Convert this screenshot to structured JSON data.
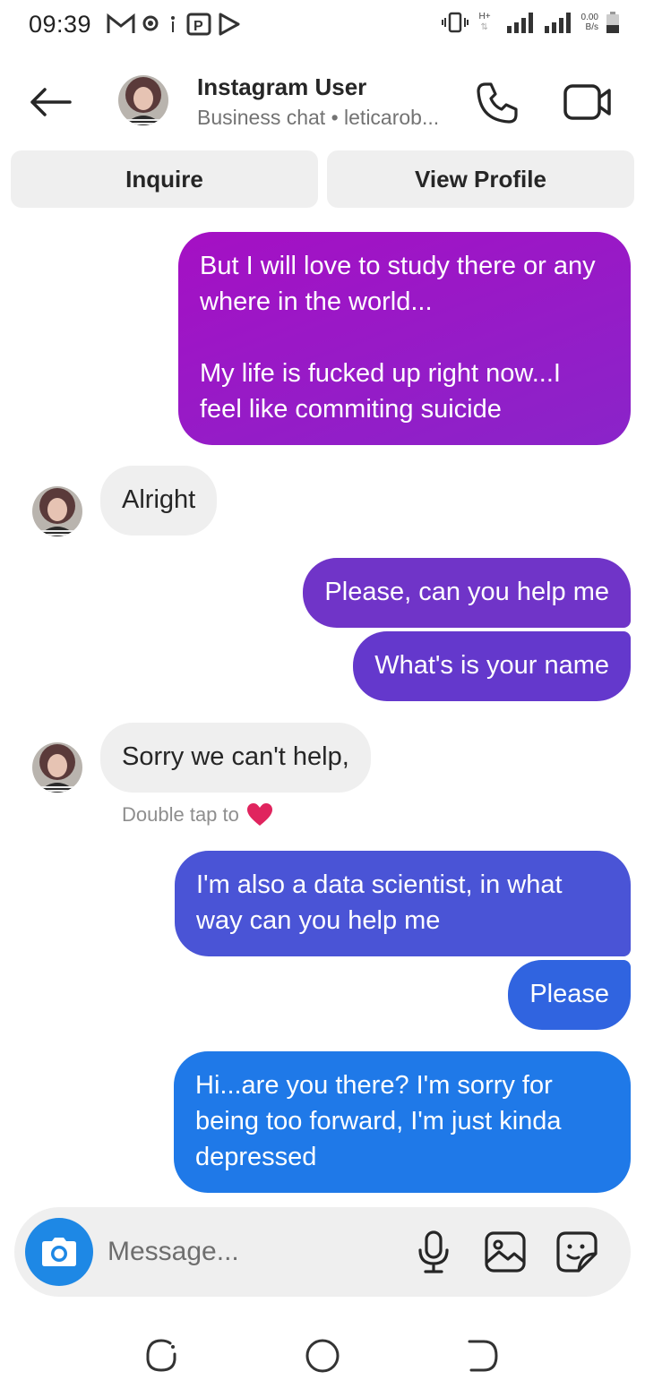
{
  "status_bar": {
    "time": "09:39",
    "net_speed_value": "0.00",
    "net_speed_unit": "B/s",
    "network_type": "H+"
  },
  "header": {
    "name": "Instagram User",
    "subtitle": "Business chat • leticarob...",
    "icons": [
      "back-arrow-icon",
      "phone-icon",
      "video-camera-icon"
    ]
  },
  "actions": {
    "inquire": "Inquire",
    "view_profile": "View Profile"
  },
  "messages": [
    {
      "direction": "out",
      "text_line1": "But I will love to study there or any where in the world...",
      "text_line2": "My life is fucked up right now...I feel like commiting suicide"
    },
    {
      "direction": "in",
      "text": "Alright"
    },
    {
      "direction": "out",
      "text": "Please, can you help me"
    },
    {
      "direction": "out",
      "text": "What's is your name"
    },
    {
      "direction": "in",
      "text": "Sorry we can't help,"
    },
    {
      "direction": "out",
      "text": "I'm also a data scientist, in what way can you help me"
    },
    {
      "direction": "out",
      "text": "Please"
    },
    {
      "direction": "out",
      "text": "Hi...are you there? I'm sorry for being too forward, I'm just kinda depressed"
    }
  ],
  "hint": {
    "text": "Double tap to",
    "icon": "heart-icon",
    "color": "#e0245e"
  },
  "composer": {
    "placeholder": "Message...",
    "icons": [
      "camera-icon",
      "microphone-icon",
      "gallery-icon",
      "sticker-icon"
    ],
    "camera_color": "#1e88e5"
  },
  "nav": {
    "icons": [
      "recents-icon",
      "home-icon",
      "back-icon"
    ]
  }
}
